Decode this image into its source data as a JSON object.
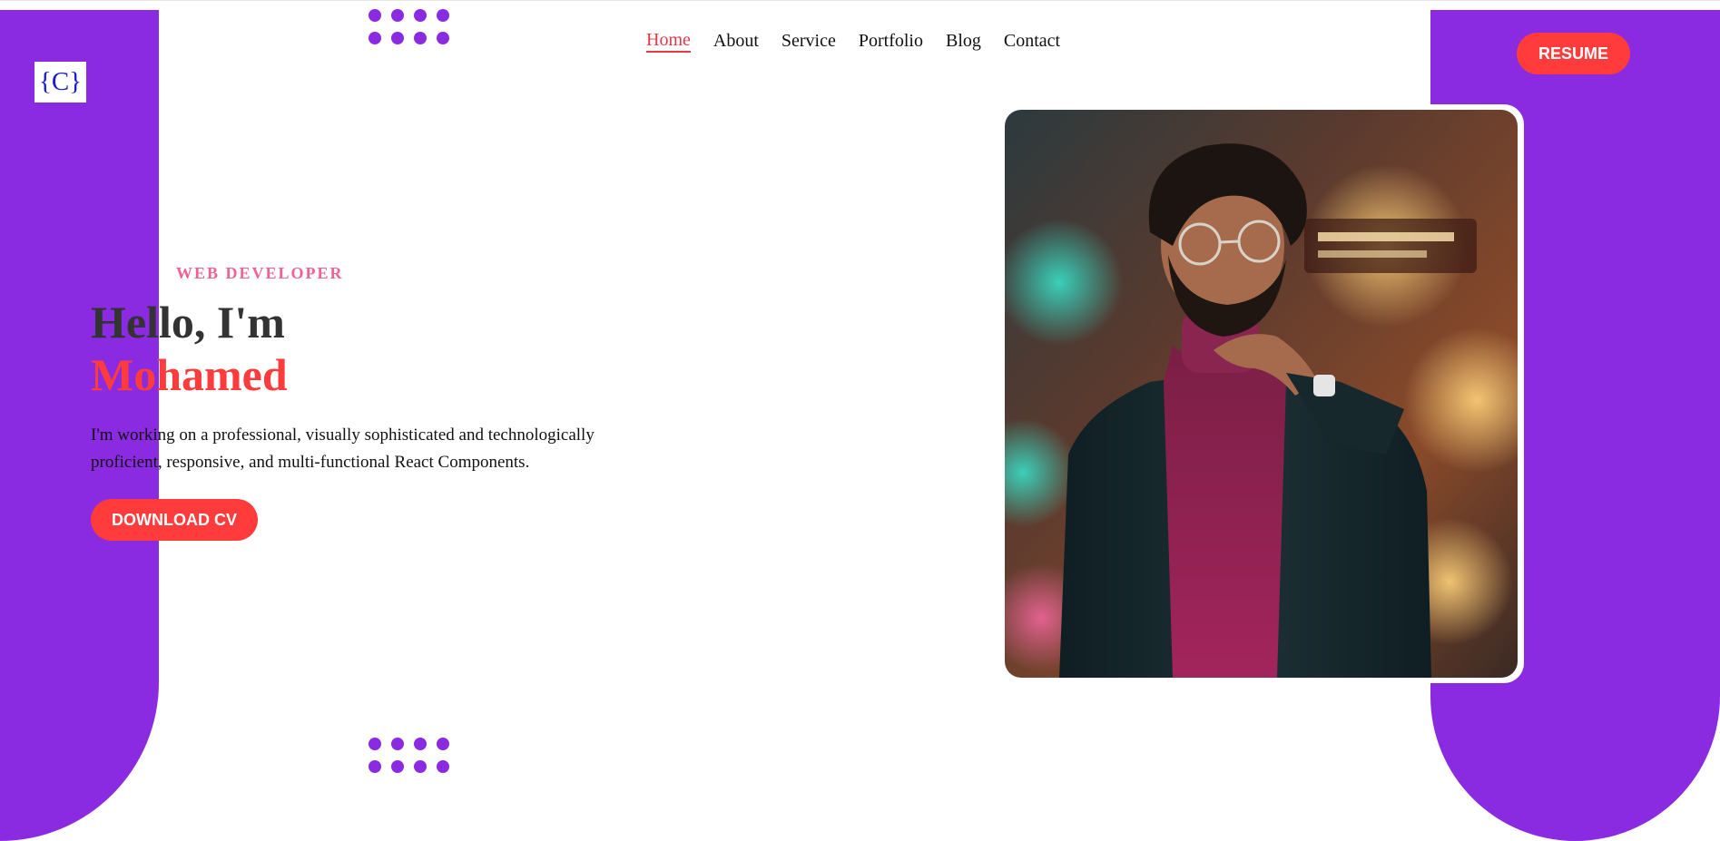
{
  "brand": {
    "logo_text": "{C}",
    "logo_color": "#1a1ad6"
  },
  "colors": {
    "purple": "#8a2be2",
    "accent_red": "#ff3b3b",
    "pink": "#f06292"
  },
  "nav": {
    "items": [
      {
        "label": "Home",
        "active": true
      },
      {
        "label": "About",
        "active": false
      },
      {
        "label": "Service",
        "active": false
      },
      {
        "label": "Portfolio",
        "active": false
      },
      {
        "label": "Blog",
        "active": false
      },
      {
        "label": "Contact",
        "active": false
      }
    ]
  },
  "header": {
    "resume_label": "RESUME"
  },
  "hero": {
    "role": "WEB DEVELOPER",
    "greeting": "Hello, I'm",
    "name": "Mohamed",
    "description": "I'm working on a professional, visually sophisticated and technologically proficient, responsive, and multi-functional React Components.",
    "download_label": "DOWNLOAD CV",
    "portrait_icon": "portrait-photo"
  }
}
